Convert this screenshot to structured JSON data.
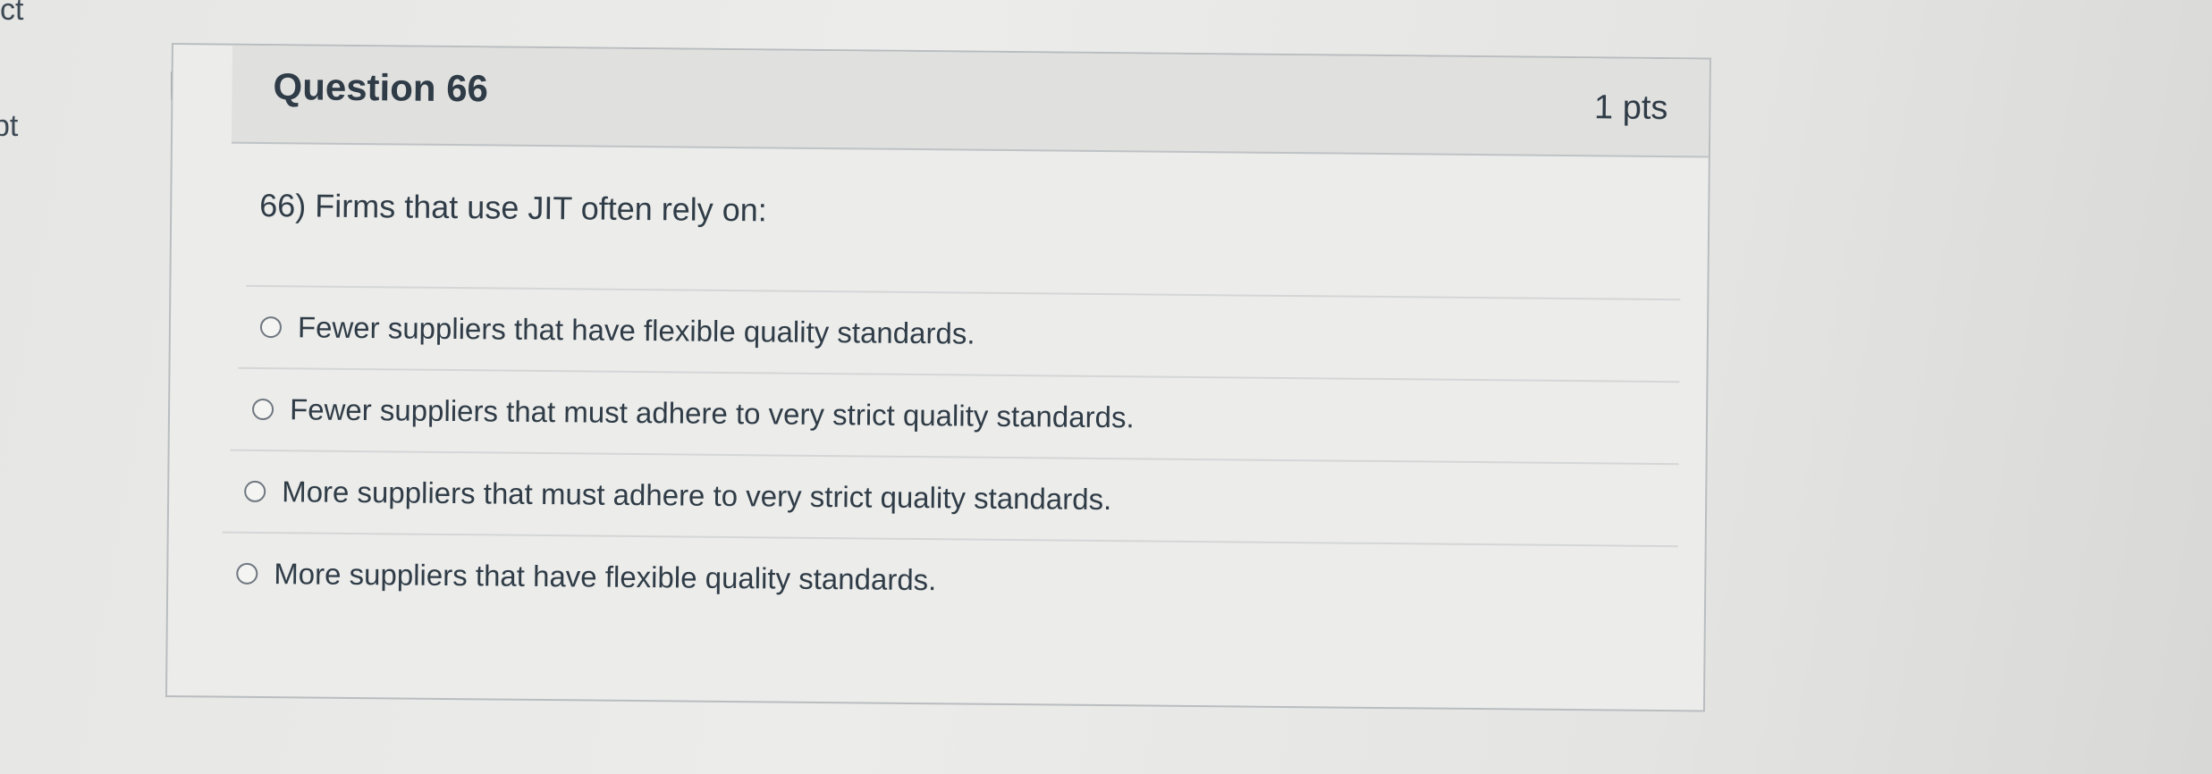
{
  "side": {
    "top_fragment": "ct",
    "mid_fragment": "pt"
  },
  "question": {
    "title": "Question 66",
    "points": "1 pts",
    "text": "66) Firms that use JIT often rely on:",
    "answers": [
      {
        "label": "Fewer suppliers that have flexible quality standards."
      },
      {
        "label": "Fewer suppliers that must adhere to very strict quality standards."
      },
      {
        "label": "More suppliers that must adhere to very strict quality standards."
      },
      {
        "label": "More suppliers that have flexible quality standards."
      }
    ]
  },
  "icons": {
    "flag": "flag-question-icon",
    "radio": "radio-unchecked-icon"
  },
  "colors": {
    "text": "#2f3c47",
    "border": "#b9bdc0",
    "header_bg": "#e0e0de"
  }
}
